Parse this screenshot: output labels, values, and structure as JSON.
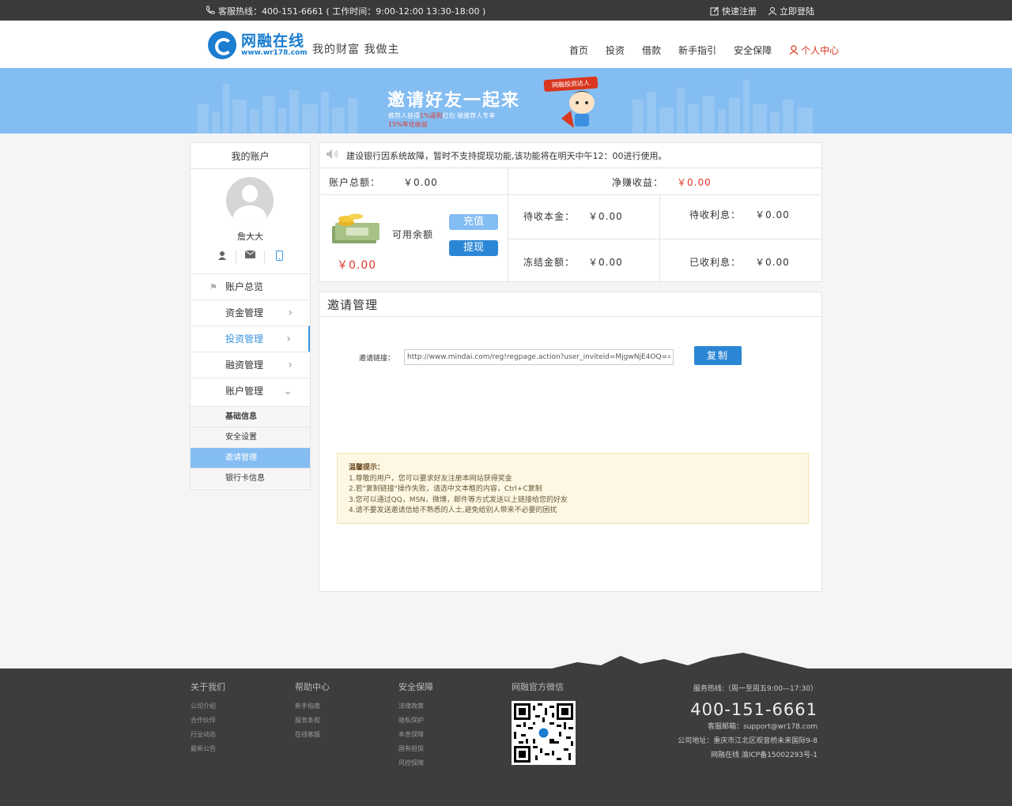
{
  "topbar": {
    "hotline": "客服热线：400-151-6661 ( 工作时间：9:00-12:00 13:30-18:00 )",
    "register": "快速注册",
    "login": "立即登陆"
  },
  "header": {
    "logo_main": "网融在线",
    "logo_url": "www.wr178.com",
    "slogan": "我的财富 我做主",
    "nav": [
      "首页",
      "投资",
      "借款",
      "新手指引",
      "安全保障"
    ],
    "personal_center": "个人中心"
  },
  "banner": {
    "headline": "邀请好友一起来",
    "sub_a": "推荐人获得",
    "sub_b": "1%返利",
    "sub_c": "红包 被推荐人专享",
    "sub_d": "15%年化收益",
    "ribbon": "网融投资达人"
  },
  "sidebar": {
    "title": "我的账户",
    "username": "詹大大",
    "menu": [
      "账户总览",
      "资金管理",
      "投资管理",
      "融资管理",
      "账户管理"
    ],
    "submenu": [
      "基础信息",
      "安全设置",
      "邀请管理",
      "银行卡信息"
    ]
  },
  "notice": "建设银行因系统故障，暂时不支持提现功能,该功能将在明天中午12：00进行使用。",
  "account": {
    "total_label": "账户总额：",
    "total_value": "￥0.00",
    "net_label": "净赚收益：",
    "net_value": "￥0.00",
    "balance_label": "可用余额",
    "balance_value": "￥0.00",
    "recharge": "充值",
    "withdraw": "提现",
    "pending_principal_label": "待收本金：",
    "pending_principal_value": "￥0.00",
    "pending_interest_label": "待收利息：",
    "pending_interest_value": "￥0.00",
    "frozen_label": "冻结金额：",
    "frozen_value": "￥0.00",
    "received_interest_label": "已收利息：",
    "received_interest_value": "￥0.00"
  },
  "invite": {
    "title": "邀请管理",
    "link_label": "邀请链接：",
    "link_value": "http://www.mindai.com/reg!regpage.action?user_inviteid=MjgwNjE4OQ==",
    "copy": "复制",
    "tips_title": "温馨提示：",
    "tips": [
      "1.尊敬的用户，您可以要求好友注册本网站获得奖金",
      "2.若\"复制链接\"操作失败，请选中文本框的内容，Ctrl+C复制",
      "3.您可以通过QQ，MSN，微博，邮件等方式发送以上链接给您的好友",
      "4.请不要发送邀请信给不熟悉的人士,避免给别人带来不必要的困扰"
    ]
  },
  "footer": {
    "cols": [
      {
        "title": "关于我们",
        "links": [
          "公司介绍",
          "合作伙伴",
          "行业动态",
          "最新公告"
        ]
      },
      {
        "title": "帮助中心",
        "links": [
          "新手指南",
          "服务条款",
          "在线客服"
        ]
      },
      {
        "title": "安全保障",
        "links": [
          "法律政策",
          "隐私保护",
          "本息保障",
          "国有担保",
          "风控保障"
        ]
      }
    ],
    "wechat_title": "网融官方微信",
    "service_hours": "服务热线:（周一至周五9:00—17:30）",
    "phone": "400-151-6661",
    "email": "客服邮箱：support@wr178.com",
    "address": "公司地址：重庆市江北区观音桥未来国际9-8",
    "icp": "网融在线  渝ICP备15002293号-1"
  },
  "colors": {
    "brand_blue": "#1a7dd0",
    "banner_blue": "#84bdf2",
    "accent_red": "#e0382a",
    "footer_bg": "#3d3d3d"
  }
}
